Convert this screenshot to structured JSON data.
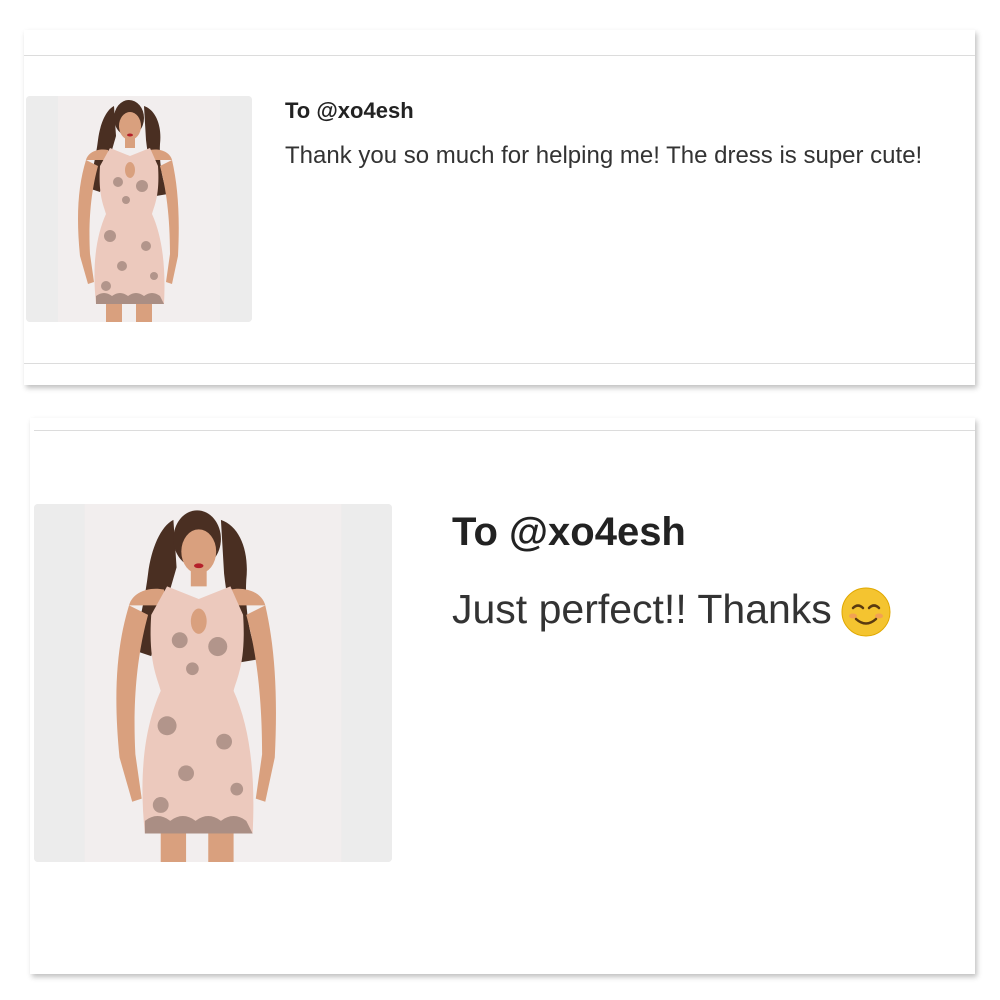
{
  "messages": [
    {
      "recipient": "To @xo4esh",
      "text": "Thank you so much for helping me! The dress is super cute!",
      "image": "product-photo-dress-icon"
    },
    {
      "recipient": "To @xo4esh",
      "text": "Just perfect!! Thanks",
      "emoji": "smiling-face-with-smiling-eyes-icon",
      "image": "product-photo-dress-icon"
    }
  ],
  "colors": {
    "background": "#ffffff",
    "divider": "#dcdcdc",
    "thumb_bg": "#ececec",
    "text": "#222222",
    "dress": "#ecc9bd",
    "sequin": "#9a8076",
    "skin": "#d9a07e",
    "hair": "#4a2f22",
    "emoji": "#f4c430"
  }
}
